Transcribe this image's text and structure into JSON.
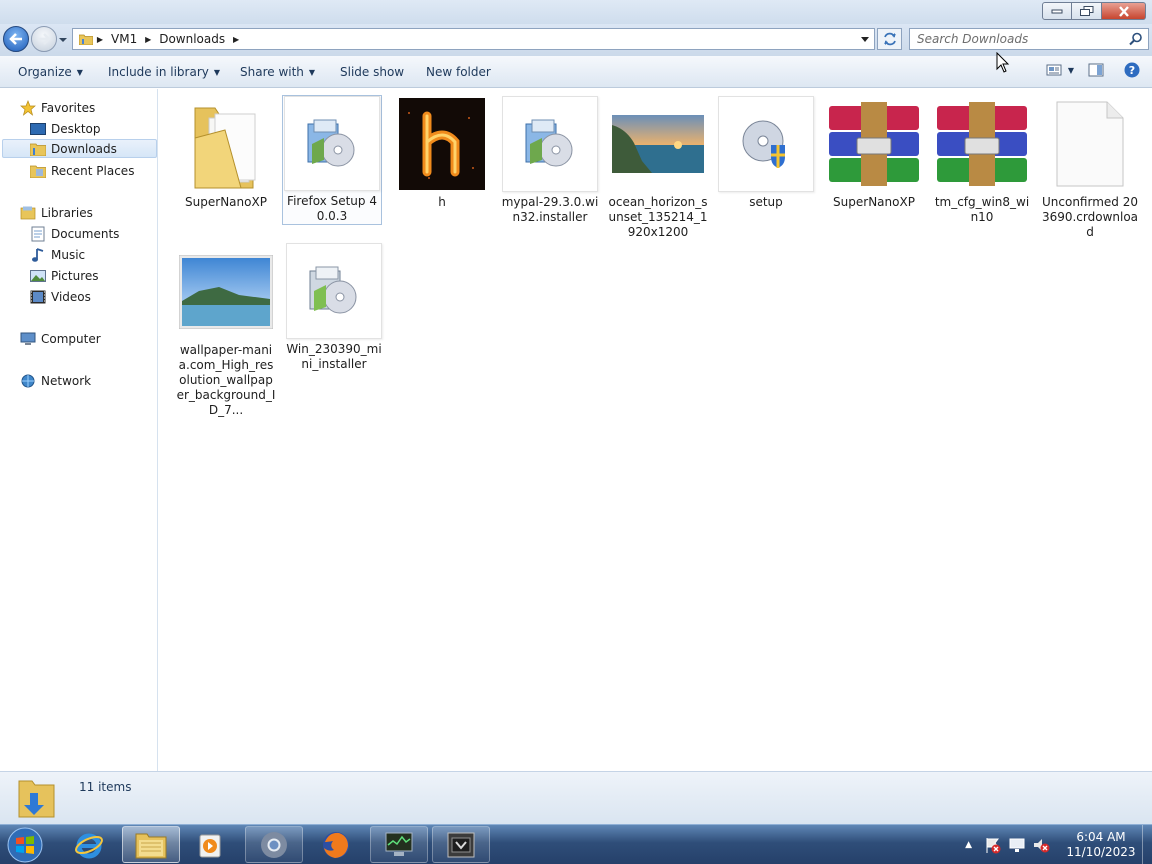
{
  "window": {
    "minimize_label": "",
    "maximize_label": "",
    "close_label": ""
  },
  "address": {
    "crumbs": [
      "VM1",
      "Downloads"
    ]
  },
  "search": {
    "placeholder": "Search Downloads"
  },
  "toolbar": {
    "organize": "Organize",
    "include_in_library": "Include in library",
    "share_with": "Share with",
    "slide_show": "Slide show",
    "new_folder": "New folder"
  },
  "sidebar": {
    "favorites": "Favorites",
    "desktop": "Desktop",
    "downloads": "Downloads",
    "recent_places": "Recent Places",
    "libraries": "Libraries",
    "documents": "Documents",
    "music": "Music",
    "pictures": "Pictures",
    "videos": "Videos",
    "computer": "Computer",
    "network": "Network"
  },
  "files": [
    {
      "name": "SuperNanoXP",
      "icon": "folder-icon"
    },
    {
      "name": "Firefox Setup 40.0.3",
      "icon": "installer-icon"
    },
    {
      "name": "h",
      "icon": "image-thumbnail"
    },
    {
      "name": "mypal-29.3.0.win32.installer",
      "icon": "installer-icon"
    },
    {
      "name": "ocean_horizon_sunset_135214_1920x1200",
      "icon": "image-thumbnail"
    },
    {
      "name": "setup",
      "icon": "setup-icon"
    },
    {
      "name": "SuperNanoXP",
      "icon": "archive-icon"
    },
    {
      "name": "tm_cfg_win8_win10",
      "icon": "archive-icon"
    },
    {
      "name": "Unconfirmed 203690.crdownload",
      "icon": "blank-file-icon"
    },
    {
      "name": "wallpaper-mania.com_High_resolution_wallpaper_background_ID_7...",
      "icon": "image-thumbnail"
    },
    {
      "name": "Win_230390_mini_installer",
      "icon": "installer-icon"
    }
  ],
  "status": {
    "item_count": "11 items"
  },
  "taskbar": {
    "time": "6:04 AM",
    "date": "11/10/2023"
  },
  "colors": {
    "selection": "#cce8ff",
    "taskbar": "#2f4e79",
    "link_text": "#1e395b"
  }
}
